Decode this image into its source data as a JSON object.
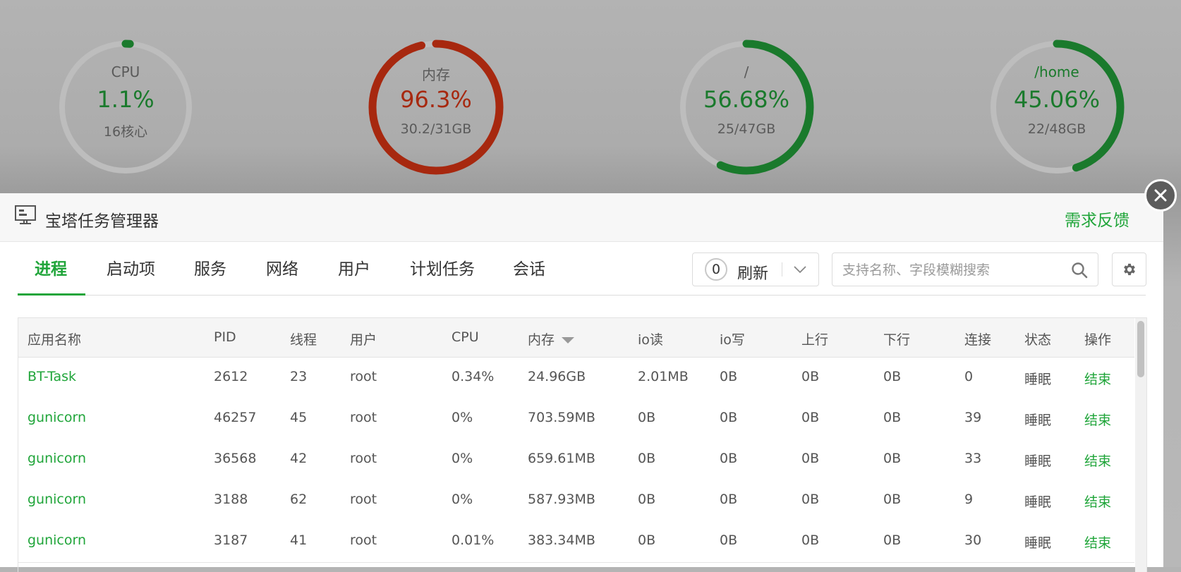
{
  "gauges": [
    {
      "name": "CPU",
      "percent": "1.1%",
      "sub": "16核心",
      "value": 1.1,
      "color": "#1a7a2c"
    },
    {
      "name": "内存",
      "percent": "96.3%",
      "sub": "30.2/31GB",
      "value": 96.3,
      "color": "#a7280f"
    },
    {
      "name": "/",
      "percent": "56.68%",
      "sub": "25/47GB",
      "value": 56.68,
      "color": "#1a7a2c"
    },
    {
      "name": "/home",
      "percent": "45.06%",
      "sub": "22/48GB",
      "value": 45.06,
      "color": "#1a7a2c"
    }
  ],
  "modal": {
    "title": "宝塔任务管理器",
    "feedback": "需求反馈",
    "icon": "monitor-icon",
    "close_icon": "close-icon"
  },
  "tabs": [
    {
      "label": "进程",
      "active": true
    },
    {
      "label": "启动项"
    },
    {
      "label": "服务"
    },
    {
      "label": "网络"
    },
    {
      "label": "用户"
    },
    {
      "label": "计划任务"
    },
    {
      "label": "会话"
    }
  ],
  "toolbar": {
    "refresh_count": "0",
    "refresh_label": "刷新",
    "search_placeholder": "支持名称、字段模糊搜索",
    "search_value": "",
    "settings_icon": "gear-icon"
  },
  "table": {
    "headers": [
      "应用名称",
      "PID",
      "线程",
      "用户",
      "CPU",
      "内存",
      "io读",
      "io写",
      "上行",
      "下行",
      "连接",
      "状态",
      "操作"
    ],
    "sorted_column": "内存",
    "rows": [
      [
        "BT-Task",
        "2612",
        "23",
        "root",
        "0.34%",
        "24.96GB",
        "2.01MB",
        "0B",
        "0B",
        "0B",
        "0",
        "睡眠",
        "结束"
      ],
      [
        "gunicorn",
        "46257",
        "45",
        "root",
        "0%",
        "703.59MB",
        "0B",
        "0B",
        "0B",
        "0B",
        "39",
        "睡眠",
        "结束"
      ],
      [
        "gunicorn",
        "36568",
        "42",
        "root",
        "0%",
        "659.61MB",
        "0B",
        "0B",
        "0B",
        "0B",
        "33",
        "睡眠",
        "结束"
      ],
      [
        "gunicorn",
        "3188",
        "62",
        "root",
        "0%",
        "587.93MB",
        "0B",
        "0B",
        "0B",
        "0B",
        "9",
        "睡眠",
        "结束"
      ],
      [
        "gunicorn",
        "3187",
        "41",
        "root",
        "0.01%",
        "383.34MB",
        "0B",
        "0B",
        "0B",
        "0B",
        "30",
        "睡眠",
        "结束"
      ]
    ]
  },
  "colors": {
    "accent": "#20a53a",
    "danger": "#a7280f",
    "gauge_track": "#bdbdbd"
  }
}
